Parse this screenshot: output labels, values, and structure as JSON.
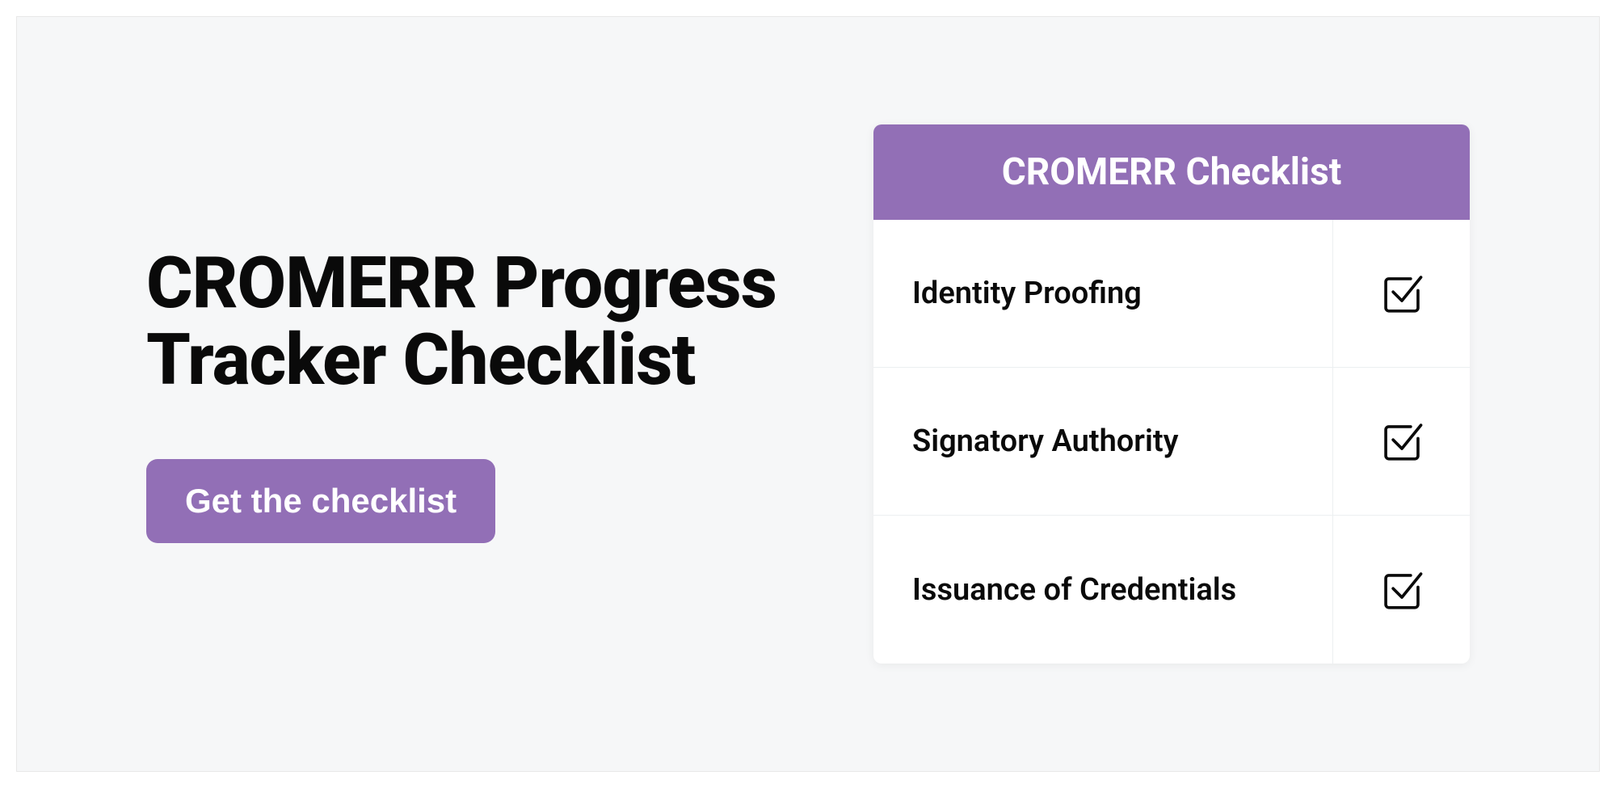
{
  "colors": {
    "accent": "#926fb6",
    "text": "#0a0a0a",
    "background": "#f6f7f8"
  },
  "left": {
    "heading": "CROMERR Progress Tracker Checklist",
    "cta_label": "Get the checklist"
  },
  "checklist": {
    "title": "CROMERR Checklist",
    "items": [
      {
        "label": "Identity Proofing",
        "checked": true
      },
      {
        "label": "Signatory Authority",
        "checked": true
      },
      {
        "label": "Issuance of Credentials",
        "checked": true
      }
    ]
  }
}
